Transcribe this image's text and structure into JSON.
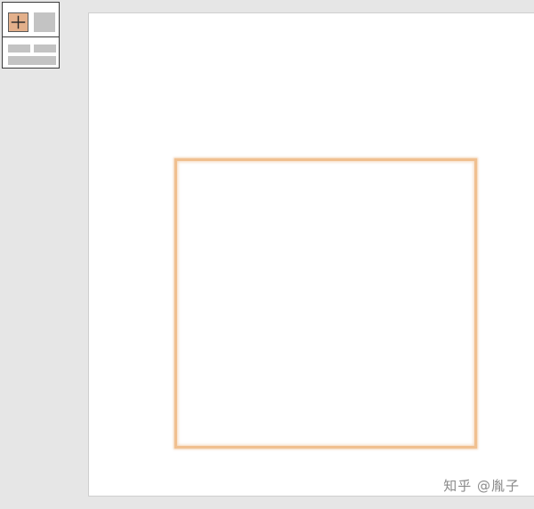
{
  "palette": {
    "tools": [
      {
        "name": "add-shape",
        "icon": "plus-icon",
        "accent": "#e3b08b"
      },
      {
        "name": "filled-block",
        "icon": "block-icon",
        "color": "#c3c3c3"
      },
      {
        "name": "layout",
        "icon": "layout-icon",
        "color": "#c3c3c3"
      }
    ]
  },
  "canvas": {
    "background": "#ffffff",
    "shape": {
      "type": "rectangle",
      "selected": true,
      "outline_color": "#f0c090"
    }
  },
  "watermark": {
    "text": "知乎 @胤子"
  }
}
